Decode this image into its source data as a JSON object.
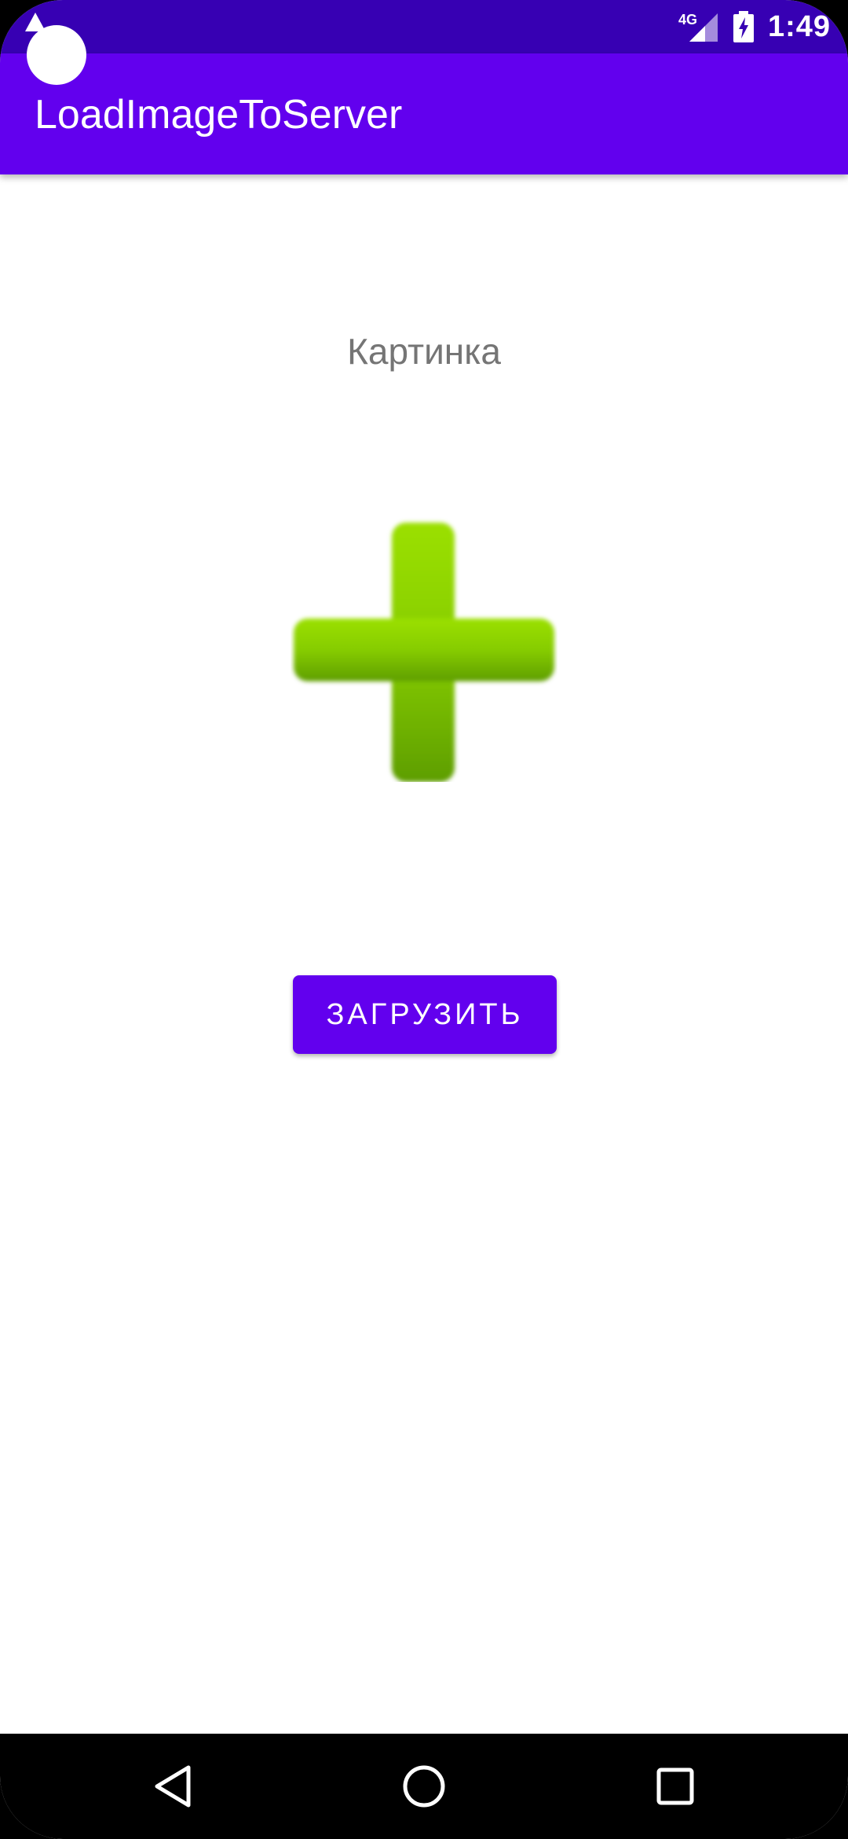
{
  "status_bar": {
    "network": "4G",
    "time": "1:49",
    "icons": [
      "warning-icon",
      "signal-icon",
      "battery-charging-icon"
    ],
    "background": "#3700B3"
  },
  "app_bar": {
    "title": "LoadImageToServer",
    "background": "#6200EE"
  },
  "content": {
    "picture_label": "Картинка",
    "image_icon": "green-plus-icon",
    "upload_button_label": "ЗАГРУЗИТЬ",
    "accent": "#6200EE",
    "plus_color": "#7CC400"
  },
  "nav_bar": {
    "icons": [
      "back-icon",
      "home-icon",
      "recents-icon"
    ]
  }
}
